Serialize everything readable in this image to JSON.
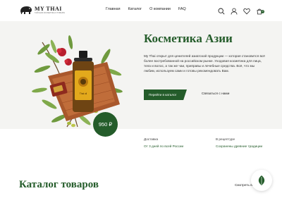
{
  "brand": {
    "name": "MY THAI",
    "tagline": "ТАЙСКАЯ КОСМЕТИКА И ТОВАРЫ"
  },
  "nav": [
    {
      "label": "Главная"
    },
    {
      "label": "Каталог"
    },
    {
      "label": "О компании"
    },
    {
      "label": "FAQ"
    }
  ],
  "header_icons": [
    "search-icon",
    "user-icon",
    "heart-icon",
    "cart-icon"
  ],
  "cart": {
    "count": "0"
  },
  "hero": {
    "title": "Косметика Азии",
    "description": "My Thai открыт для ценителей азиатской продукции — которая становится всё более востребованной на российском рынке. Уходовая косметика для лица, тела и волос, а так же чаи, приправы и лечебные средства. Всё, что мы любим, используем сами и готовы рекомендовать Вам.",
    "primary_button": "Перейти в каталог",
    "secondary_link": "Связаться с нами",
    "price": "950 ₽",
    "product_label": "Thai oil"
  },
  "info": [
    {
      "label": "Доставка",
      "value": "От 3 дней по всей России"
    },
    {
      "label": "В рецептуре",
      "value": "Сохранены древние традиции"
    }
  ],
  "catalog": {
    "title": "Каталог товаров",
    "see_all": "Смотреть весь"
  },
  "colors": {
    "accent": "#245c2a",
    "hero_bg": "#f4f4f2",
    "wood": "#a9582c",
    "olive_leaf": "#6f9a3e",
    "flower": "#b81e2d"
  }
}
